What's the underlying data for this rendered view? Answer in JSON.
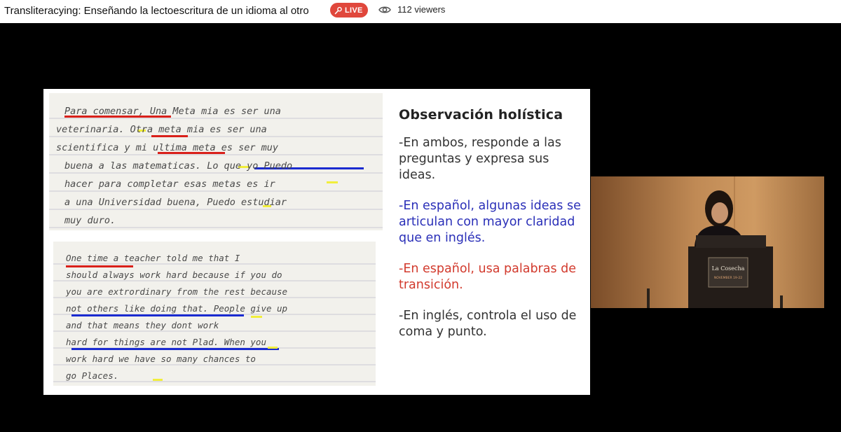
{
  "header": {
    "title": "Transliteracying: Enseñando la lectoescritura de un idioma al otro",
    "live_label": "LIVE",
    "live_icon": "microphone-icon",
    "viewers_icon": "eye-icon",
    "viewers_text": "112 viewers"
  },
  "slide": {
    "title": "Observación holística",
    "points": [
      {
        "text": "-En ambos, responde a las preguntas  y expresa sus ideas.",
        "color": "#333333"
      },
      {
        "text": "-En español, algunas ideas se articulan con mayor claridad que en inglés.",
        "color": "#2a2fb8"
      },
      {
        "text": "-En español, usa palabras de transición.",
        "color": "#d23a2d"
      },
      {
        "text": "-En inglés, controla el uso de coma y punto.",
        "color": "#333333"
      }
    ],
    "spanish_sample": [
      "Para comensar, Una Meta mia es ser una",
      "veterinaria. Otra meta mia es ser una",
      "scientifica y mi ultima meta es ser muy",
      "buena a las matematicas. Lo que yo Puedo",
      "hacer para completar esas metas es ir",
      "a una Universidad buena, Puedo estudiar",
      "muy duro."
    ],
    "english_sample": [
      "One time a teacher told me that I",
      "should always work hard because if you do",
      "you are extrordinary from the rest because",
      "not others like doing that. People give up",
      "and that means they dont work",
      "hard for things are not Plad. When you",
      "work hard we have so many chances to",
      "go Places."
    ]
  },
  "speaker_cam": {
    "podium_text": "La Cosecha",
    "podium_subtext": "NOVEMBER 19-22"
  },
  "colors": {
    "live_red": "#e0473c",
    "underline_red": "#d9201a",
    "underline_blue": "#1a2bd0",
    "highlight_yellow": "#f1ee3c"
  }
}
